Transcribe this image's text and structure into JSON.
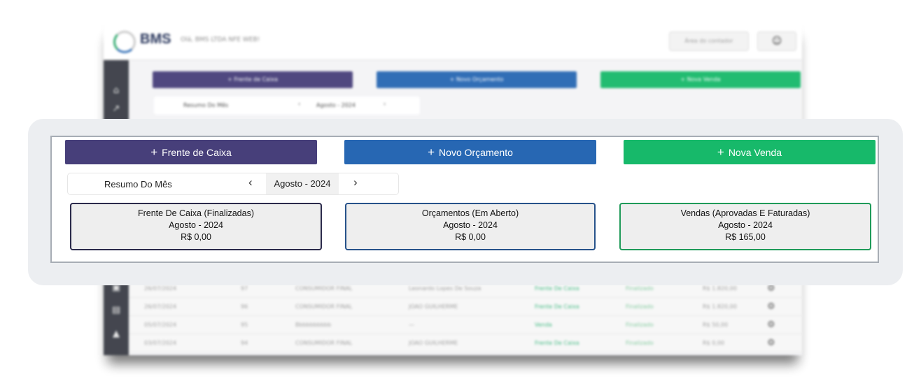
{
  "app": {
    "logo_text": "BMS",
    "greeting": "Olá, BMS LTDA NFE WEB!",
    "accountant_button": "Área do contador",
    "user_icon": "user-icon"
  },
  "sidebar": {
    "icons": [
      "home-icon",
      "chart-icon",
      "calendar-icon",
      "cash-icon",
      "store-icon"
    ]
  },
  "colors": {
    "frente_caixa": "#473f7a",
    "orcamento": "#2767b3",
    "venda": "#17b96a",
    "card_frente_border": "#2b2a4b",
    "card_orcamento_border": "#27528a",
    "card_venda_border": "#1f9a59"
  },
  "actions": {
    "frente_caixa": "Frente de Caixa",
    "novo_orcamento": "Novo Orçamento",
    "nova_venda": "Nova Venda",
    "plus_symbol": "+"
  },
  "summary": {
    "label": "Resumo Do Mês",
    "month": "Agosto - 2024",
    "prev_symbol": "‹",
    "next_symbol": "›"
  },
  "cards": [
    {
      "title": "Frente De Caixa (Finalizadas)",
      "period": "Agosto - 2024",
      "amount": "R$ 0,00"
    },
    {
      "title": "Orçamentos (Em Aberto)",
      "period": "Agosto - 2024",
      "amount": "R$ 0,00"
    },
    {
      "title": "Vendas (Aprovadas E Faturadas)",
      "period": "Agosto - 2024",
      "amount": "R$ 165,00"
    }
  ],
  "background_rows": [
    {
      "date": "26/07/2024",
      "number": "97",
      "client": "CONSUMIDOR FINAL",
      "seller": "Leonardo Lopes De Souza",
      "origin": "Frente De Caixa",
      "status": "Finalizado",
      "value": "R$ 1.820,00"
    },
    {
      "date": "26/07/2024",
      "number": "96",
      "client": "CONSUMIDOR FINAL",
      "seller": "JOAO GUILHERME",
      "origin": "Frente De Caixa",
      "status": "Finalizado",
      "value": "R$ 1.820,00"
    },
    {
      "date": "05/07/2024",
      "number": "95",
      "client": "Bbbbbbbbbb",
      "seller": "—",
      "origin": "Venda",
      "status": "Finalizado",
      "value": "R$ 50,00"
    },
    {
      "date": "03/07/2024",
      "number": "94",
      "client": "CONSUMIDOR FINAL",
      "seller": "JOAO GUILHERME",
      "origin": "Frente De Caixa",
      "status": "Finalizado",
      "value": "R$ 0,00"
    }
  ]
}
